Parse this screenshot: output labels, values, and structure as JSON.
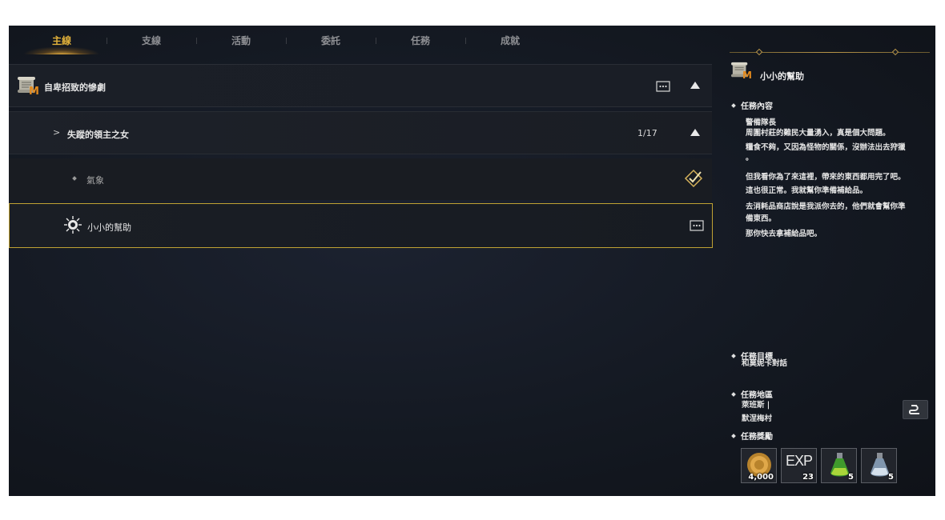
{
  "tabs": [
    {
      "label": "主線",
      "active": true
    },
    {
      "label": "支線",
      "active": false
    },
    {
      "label": "活動",
      "active": false
    },
    {
      "label": "委託",
      "active": false
    },
    {
      "label": "任務",
      "active": false
    },
    {
      "label": "成就",
      "active": false
    }
  ],
  "quest_list": {
    "main_quest": {
      "title": "自卑招致的慘劇",
      "badge": "M"
    },
    "chapter": {
      "title": "失蹤的領主之女",
      "progress": "1/17"
    },
    "weather": {
      "title": "氣象"
    },
    "current_step": {
      "title": "小小的幫助"
    }
  },
  "detail": {
    "title": "小小的幫助",
    "badge": "M",
    "content_heading": "任務內容",
    "speaker": "警備隊長",
    "dialogue": [
      "周圍村莊的難民大量湧入，真是個大問題。",
      "糧食不夠，又因為怪物的關係，沒辦法出去狩獵",
      "。",
      "但我看你為了來這裡，帶來的東西都用完了吧。",
      "這也很正常。我就幫你準備補給品。",
      "去消耗品商店說是我派你去的，他們就會幫你準",
      "備東西。",
      "那你快去拿補給品吧。"
    ],
    "goal_heading": "任務目標",
    "goal": "和莫妮卡對話",
    "area_heading": "任務地區",
    "area_lines": [
      "萊班斯 |",
      "默涅梅村"
    ],
    "reward_heading": "任務獎勵",
    "rewards": [
      {
        "icon": "gold-coin-icon",
        "count": "4,000"
      },
      {
        "icon": "exp-icon",
        "label": "EXP",
        "count": "23"
      },
      {
        "icon": "green-potion-icon",
        "count": "5"
      },
      {
        "icon": "blue-potion-icon",
        "count": "5"
      }
    ]
  },
  "colors": {
    "accent_gold": "#d9a53c",
    "selected_border": "#bfa233"
  }
}
